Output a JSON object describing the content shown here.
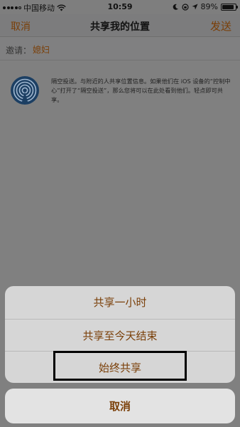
{
  "status_bar": {
    "carrier": "中国移动",
    "time": "10:59",
    "battery": "89%",
    "battery_level": 0.89,
    "icons": [
      "signal-icon",
      "wifi-icon",
      "do-not-disturb-icon",
      "rotation-lock-icon",
      "location-icon",
      "battery-icon"
    ]
  },
  "nav": {
    "cancel_label": "取消",
    "title": "共享我的位置",
    "send_label": "发送"
  },
  "invite": {
    "label": "邀请：",
    "recipient": "媳妇"
  },
  "airdrop": {
    "icon": "airdrop-icon",
    "description": "隔空投送。与附近的人共享位置信息。如果他们在 iOS 设备的“控制中心”打开了“隔空投送”，那么您将可以在此处看到他们。轻点即可共享。"
  },
  "action_sheet": {
    "options": [
      "共享一小时",
      "共享至今天结束",
      "始终共享"
    ],
    "cancel_label": "取消"
  },
  "colors": {
    "accent": "#7a3f08",
    "overlay": "#808080",
    "sheet_bg": "#d6d6d6"
  }
}
